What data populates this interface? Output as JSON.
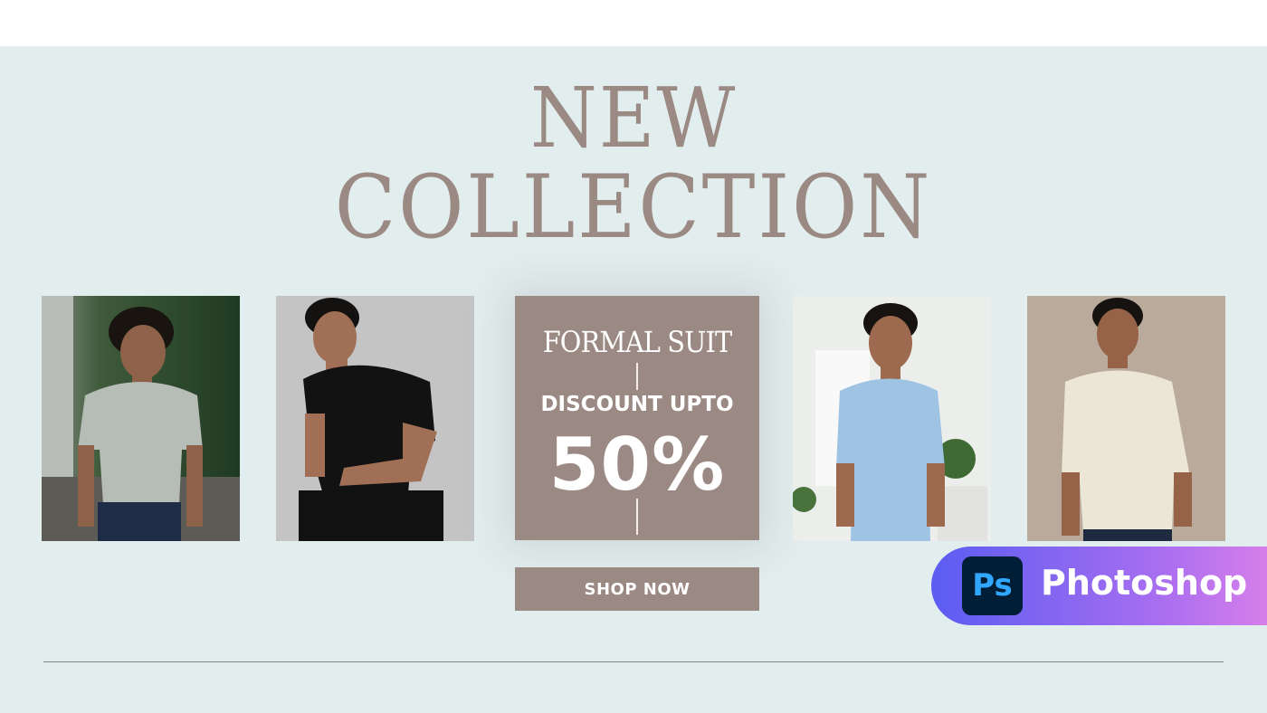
{
  "headline": {
    "line1": "NEW",
    "line2": "COLLECTION"
  },
  "promo": {
    "title": "FORMAL SUIT",
    "discount_label": "DISCOUNT UPTO",
    "discount_value": "50%"
  },
  "cta": {
    "label": "SHOP NOW"
  },
  "badge": {
    "logo_text": "Ps",
    "label": "Photoshop"
  },
  "colors": {
    "background": "#e2eeee",
    "accent": "#9b8984",
    "badge_start": "#5b5df2",
    "badge_end": "#e985e8",
    "ps_dark": "#001e36",
    "ps_blue": "#31a8ff"
  },
  "models": [
    {
      "outfit": "light gray t-shirt, jeans, outdoor green background"
    },
    {
      "outfit": "black t-shirt, black pants, gray studio background"
    },
    {
      "outfit": "light blue shirt, bright white interior"
    },
    {
      "outfit": "cream shirt, taupe studio background"
    }
  ]
}
